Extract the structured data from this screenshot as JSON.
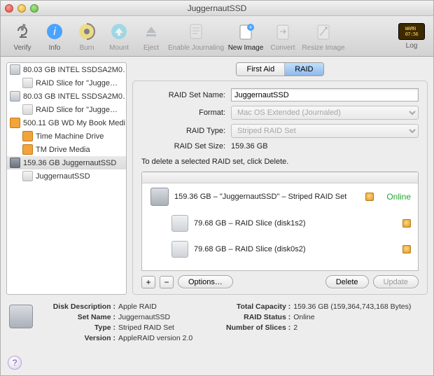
{
  "window": {
    "title": "JuggernautSSD"
  },
  "toolbar": {
    "verify": "Verify",
    "info": "Info",
    "burn": "Burn",
    "mount": "Mount",
    "eject": "Eject",
    "enable_journaling": "Enable Journaling",
    "new_image": "New Image",
    "convert": "Convert",
    "resize_image": "Resize Image",
    "log": "Log"
  },
  "sidebar": {
    "items": [
      {
        "label": "80.03 GB INTEL SSDSA2M0…",
        "children": [
          {
            "label": "RAID Slice for \"Jugge…"
          }
        ]
      },
      {
        "label": "80.03 GB INTEL SSDSA2M0…",
        "children": [
          {
            "label": "RAID Slice for \"Jugge…"
          }
        ]
      },
      {
        "label": "500.11 GB WD My Book Medi",
        "children": [
          {
            "label": "Time Machine Drive"
          },
          {
            "label": "TM Drive Media"
          }
        ]
      },
      {
        "label": "159.36 GB JuggernautSSD",
        "selected": true,
        "children": [
          {
            "label": "JuggernautSSD"
          }
        ]
      }
    ]
  },
  "tabs": {
    "first_aid": "First Aid",
    "raid": "RAID"
  },
  "form": {
    "name_label": "RAID Set Name:",
    "name_value": "JuggernautSSD",
    "format_label": "Format:",
    "format_value": "Mac OS Extended (Journaled)",
    "type_label": "RAID Type:",
    "type_value": "Striped RAID Set",
    "size_label": "RAID Set Size:",
    "size_value": "159.36 GB",
    "hint": "To delete a selected RAID set, click Delete."
  },
  "raid_list": {
    "set": {
      "text": "159.36 GB – \"JuggernautSSD\" – Striped RAID Set",
      "status": "Online"
    },
    "slices": [
      {
        "text": "79.68 GB – RAID Slice (disk1s2)"
      },
      {
        "text": "79.68 GB – RAID Slice (disk0s2)"
      }
    ]
  },
  "buttons": {
    "plus": "+",
    "minus": "−",
    "options": "Options…",
    "delete": "Delete",
    "update": "Update"
  },
  "footer": {
    "desc_l": "Disk Description :",
    "desc_v": "Apple RAID",
    "name_l": "Set Name :",
    "name_v": "JuggernautSSD",
    "type_l": "Type :",
    "type_v": "Striped RAID Set",
    "ver_l": "Version :",
    "ver_v": "AppleRAID version 2.0",
    "cap_l": "Total Capacity :",
    "cap_v": "159.36 GB (159,364,743,168 Bytes)",
    "stat_l": "RAID Status :",
    "stat_v": "Online",
    "slices_l": "Number of Slices :",
    "slices_v": "2"
  }
}
